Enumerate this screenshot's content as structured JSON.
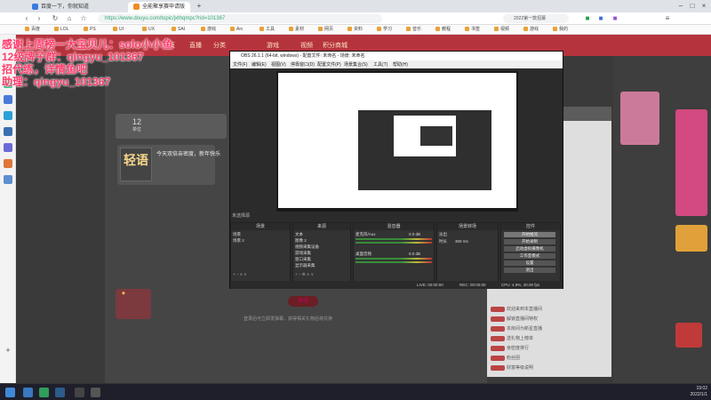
{
  "browser": {
    "tabs": [
      {
        "label": "百度一下，你就知道"
      },
      {
        "label": "全能聚享赛申请版"
      }
    ],
    "url": "https://www.douyu.com/topic/jxthqmpc?rid=101367",
    "omnibox_search": "2022第一款招募",
    "bookmarks": [
      "百度",
      "LOL",
      "PS",
      "UI",
      "UX",
      "SAI",
      "游戏",
      "Arc",
      "工具",
      "素材",
      "网页",
      "资料",
      "学习",
      "音乐",
      "教程",
      "书签",
      "视频",
      "游戏",
      "我的"
    ]
  },
  "site": {
    "nav": [
      "首页",
      "直播",
      "分类",
      "游戏",
      "视频",
      "积分商城"
    ],
    "room": {
      "rank_value": "12",
      "rank_unit": "单位"
    },
    "anchor": {
      "logo_text": "轻语",
      "notice": "今天双倍亲密度，新年快乐"
    },
    "follow_label": "关注",
    "login_hint": "登录后可立即发弹幕，获得相关礼物后将兑换"
  },
  "overlay": {
    "line1": "感谢上周榜一大宝贝儿：solo小小鱼",
    "line2": "12级牌子群：qingyu_101367",
    "line3": "招代练，详情鱼吧",
    "line4": "助理：qingyu_101367"
  },
  "obs": {
    "title": "OBS 26.1.1 (64-bit, windows) - 配置文件: 未命名 - 场景: 未命名",
    "menu": [
      "文件(F)",
      "编辑(E)",
      "视图(V)",
      "停靠窗口(D)",
      "配置文件(P)",
      "场景集合(S)",
      "工具(T)",
      "帮助(H)"
    ],
    "scene_label": "未选择源",
    "docks": {
      "scenes": {
        "title": "场景",
        "items": [
          "场景",
          "场景 2"
        ]
      },
      "sources": {
        "title": "来源",
        "items": [
          "文本",
          "图像 2",
          "视频采集设备",
          "游戏采集",
          "窗口采集",
          "显示器采集"
        ]
      },
      "mixer": {
        "title": "混音器",
        "items": [
          {
            "name": "桌面音频",
            "level": "0.0 dB"
          },
          {
            "name": "麦克风/Aux",
            "level": "0.0 dB"
          }
        ]
      },
      "transitions": {
        "title": "场景转场",
        "fade": "淡出",
        "duration_label": "时长",
        "duration": "300 ms"
      },
      "controls": {
        "title": "控件",
        "buttons": [
          "开始推流",
          "开始录制",
          "启动虚拟摄像机",
          "工作室模式",
          "设置",
          "退出"
        ]
      }
    },
    "status": {
      "live": "LIVE: 00:00:00",
      "rec": "REC: 00:00:00",
      "cpu": "CPU: 4.9%, 30.00 fps"
    }
  },
  "chat": {
    "rows": [
      "欢迎来到本直播间",
      "解锁直播间特权",
      "本房间为新星直播",
      "送礼物上榜单",
      "亲密度排行",
      "粉丝团",
      "财富等级说明",
      "新人报到"
    ]
  },
  "taskbar": {
    "time": "19:02",
    "date": "2022/1/1"
  }
}
